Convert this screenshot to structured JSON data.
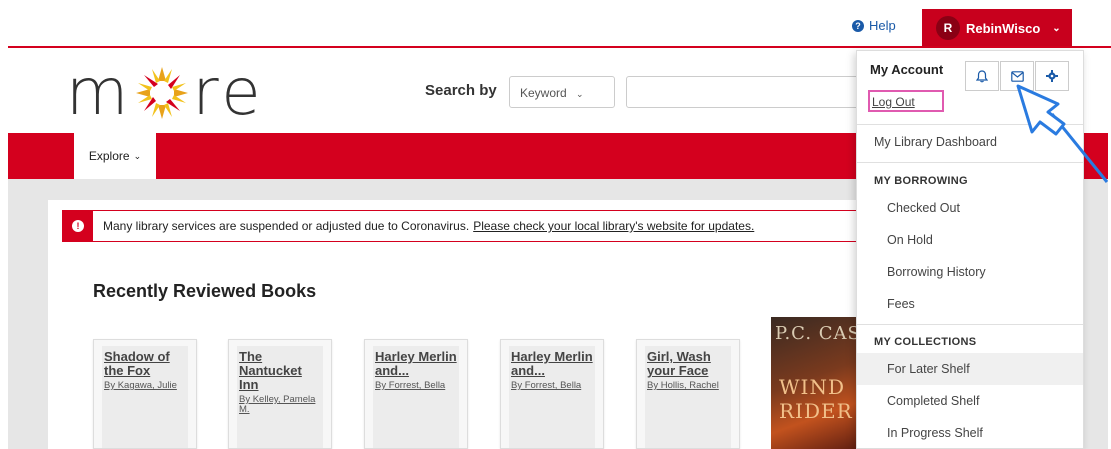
{
  "header": {
    "help_label": "Help",
    "user": {
      "initial": "R",
      "name": "RebinWisco"
    }
  },
  "logo": {
    "text_before": "m",
    "text_after": "re"
  },
  "search": {
    "label": "Search by",
    "type_selected": "Keyword",
    "query_value": ""
  },
  "nav": {
    "explore_label": "Explore"
  },
  "alert": {
    "message": "Many library services are suspended or adjusted due to Coronavirus.",
    "link": "Please check your local library's website for updates."
  },
  "section": {
    "title": "Recently Reviewed Books"
  },
  "books": [
    {
      "title": "Shadow of the Fox",
      "author": "By Kagawa, Julie"
    },
    {
      "title": "The Nantucket Inn",
      "author": "By Kelley, Pamela M."
    },
    {
      "title": "Harley Merlin and...",
      "author": "By Forrest, Bella"
    },
    {
      "title": "Harley Merlin and...",
      "author": "By Forrest, Bella"
    },
    {
      "title": "Girl, Wash your Face",
      "author": "By Hollis, Rachel"
    }
  ],
  "cover": {
    "line1": "P.C. CAS",
    "line2": "WIND",
    "line3": "RIDER"
  },
  "dropdown": {
    "my_account": "My Account",
    "log_out": "Log Out",
    "dashboard": "My Library Dashboard",
    "borrowing_head": "MY BORROWING",
    "borrowing": [
      "Checked Out",
      "On Hold",
      "Borrowing History",
      "Fees"
    ],
    "collections_head": "MY COLLECTIONS",
    "collections": [
      "For Later Shelf",
      "Completed Shelf",
      "In Progress Shelf"
    ]
  },
  "colors": {
    "brand_red": "#d4001e",
    "user_red": "#c8001d",
    "link_blue": "#1a5aa8",
    "annotation_blue": "#2a7be0"
  }
}
